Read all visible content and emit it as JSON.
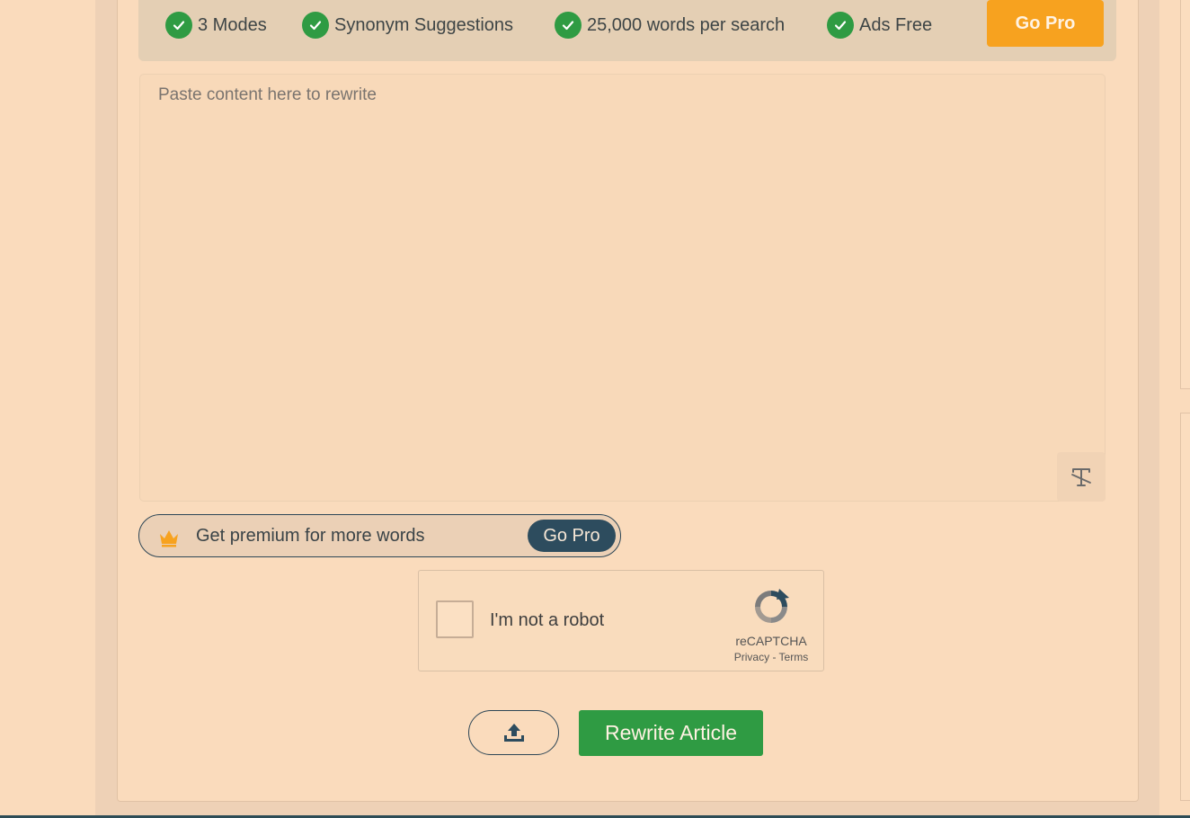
{
  "promo": {
    "features": [
      {
        "label": "3 Modes",
        "icon": "check-circle-icon"
      },
      {
        "label": "Synonym Suggestions",
        "icon": "check-circle-icon"
      },
      {
        "label": "25,000 words per search",
        "icon": "check-circle-icon"
      },
      {
        "label": "Ads Free",
        "icon": "check-circle-icon"
      }
    ],
    "go_pro_label": "Go Pro"
  },
  "editor": {
    "placeholder": "Paste content here to rewrite",
    "value": "",
    "format_icon": "clear-format-icon"
  },
  "premium": {
    "text": "Get premium for more words",
    "go_pro_label": "Go Pro",
    "icon": "crown-icon"
  },
  "captcha": {
    "label": "I'm not a robot",
    "brand": "reCAPTCHA",
    "links": "Privacy - Terms",
    "icon": "recaptcha-icon"
  },
  "actions": {
    "upload_icon": "upload-icon",
    "rewrite_label": "Rewrite Article"
  },
  "colors": {
    "accent_green": "#2f9b43",
    "accent_orange": "#f7a21f",
    "dark_teal": "#2d4c5e",
    "background": "#fadbbc"
  }
}
